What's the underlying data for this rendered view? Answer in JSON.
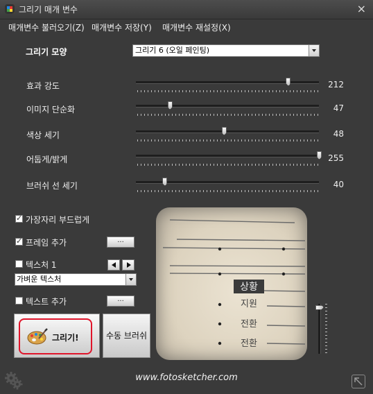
{
  "window": {
    "title": "그리기 매개 변수",
    "close_symbol": "×"
  },
  "menu": [
    {
      "label": "매개변수 불러오기(Z)"
    },
    {
      "label": "매개변수 저장(Y)"
    },
    {
      "label": "매개변수 재설정(X)"
    }
  ],
  "drawing_style": {
    "label": "그리기 모양",
    "value": "그리기 6 (오일 페인팅)"
  },
  "sliders": [
    {
      "label": "효과 강도",
      "value": 212,
      "max": 255,
      "display": "212"
    },
    {
      "label": "이미지 단순화",
      "value": 47,
      "max": 255,
      "display": "47"
    },
    {
      "label": "색상 세기",
      "value": 48,
      "max": 100,
      "display": "48"
    },
    {
      "label": "어둡게/밝게",
      "value": 255,
      "max": 255,
      "display": "255"
    },
    {
      "label": "브러쉬 선 세기",
      "value": 40,
      "max": 255,
      "display": "40"
    }
  ],
  "options": {
    "soft_edges": {
      "label": "가장자리 부드럽게",
      "checked": true
    },
    "add_frame": {
      "label": "프레임 추가",
      "checked": true,
      "button": "..."
    },
    "texture": {
      "label": "텍스처 1",
      "checked": false,
      "select_value": "가벼운 텍스처"
    },
    "add_text": {
      "label": "텍스트 추가",
      "checked": false,
      "button": "..."
    }
  },
  "buttons": {
    "draw": "그리기!",
    "manual_brush": "수동 브러쉬"
  },
  "preview": {
    "words": [
      "상황",
      "지원",
      "전환",
      "전환"
    ],
    "zoom_level": 0.05
  },
  "footer": {
    "website": "www.fotosketcher.com"
  },
  "icons": {
    "app": "app-logo-icon",
    "close": "close-icon",
    "palette": "palette-icon",
    "settings": "gear-icon",
    "resize": "resize-icon"
  },
  "colors": {
    "background": "#3a3a3a",
    "highlight": "#e0142a"
  }
}
